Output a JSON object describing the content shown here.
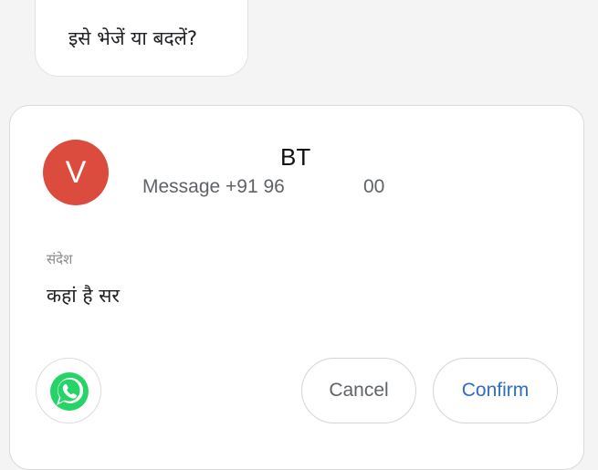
{
  "prompt_bubble": {
    "text": "इसे भेजें या बदलें?"
  },
  "contact": {
    "avatar_letter": "V",
    "name": "BT",
    "subtitle": "Message +91 96",
    "number_suffix": "00"
  },
  "message": {
    "label": "संदेश",
    "body": "कहां है सर"
  },
  "actions": {
    "app_icon": "whatsapp-icon",
    "cancel_label": "Cancel",
    "confirm_label": "Confirm"
  },
  "colors": {
    "avatar": "#db4b3e",
    "whatsapp": "#25d366",
    "confirm_text": "#2f6dbd",
    "background": "#f4f4f4"
  }
}
